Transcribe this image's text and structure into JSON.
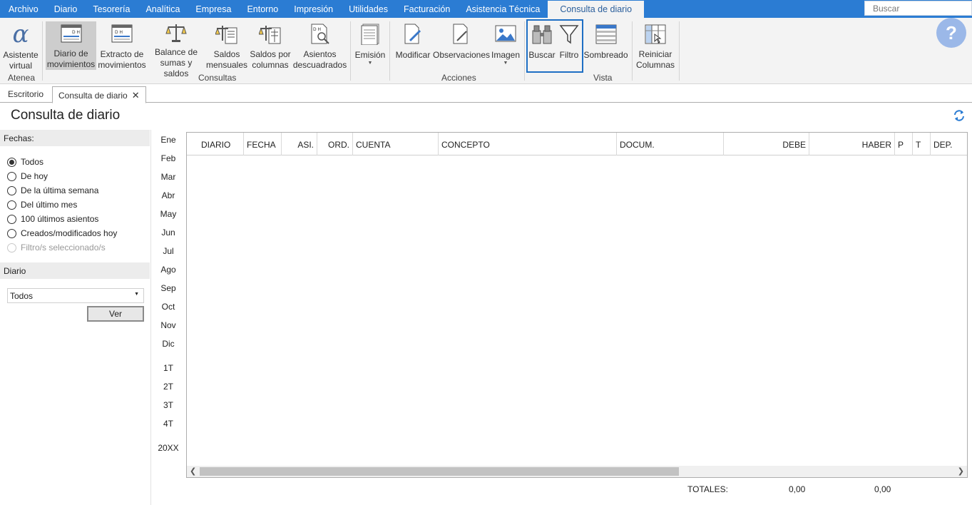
{
  "menubar": {
    "items": [
      "Archivo",
      "Diario",
      "Tesorería",
      "Analítica",
      "Empresa",
      "Entorno",
      "Impresión",
      "Utilidades",
      "Facturación",
      "Asistencia Técnica",
      "Consulta de diario"
    ],
    "search_placeholder": "Buscar"
  },
  "ribbon": {
    "atenea": {
      "asistente": "Asistente\nvirtual",
      "group": "Atenea"
    },
    "consultas": {
      "diario": "Diario de\nmovimientos",
      "extracto": "Extracto de\nmovimientos",
      "balance": "Balance de\nsumas y saldos",
      "saldos_mensuales": "Saldos\nmensuales",
      "saldos_columnas": "Saldos por\ncolumnas",
      "asientos": "Asientos\ndescuadrados",
      "group": "Consultas"
    },
    "emision": {
      "label": "Emisión"
    },
    "acciones": {
      "modificar": "Modificar",
      "observaciones": "Observaciones",
      "imagen": "Imagen",
      "group": "Acciones"
    },
    "vista": {
      "buscar": "Buscar",
      "filtro": "Filtro",
      "sombreado": "Sombreado",
      "reiniciar": "Reiniciar\nColumnas",
      "group": "Vista"
    },
    "help_glyph": "?"
  },
  "tabs": {
    "escritorio": "Escritorio",
    "consulta": "Consulta de diario",
    "close": "✕"
  },
  "page_title": "Consulta de diario",
  "fechas": {
    "heading": "Fechas:",
    "options": [
      "Todos",
      "De hoy",
      "De la última semana",
      "Del último mes",
      "100 últimos asientos",
      "Creados/modificados hoy",
      "Filtro/s seleccionado/s"
    ],
    "selected": "Todos"
  },
  "diario": {
    "heading": "Diario",
    "selected": "Todos",
    "ver_button": "Ver"
  },
  "months": [
    "Ene",
    "Feb",
    "Mar",
    "Abr",
    "May",
    "Jun",
    "Jul",
    "Ago",
    "Sep",
    "Oct",
    "Nov",
    "Dic"
  ],
  "quarters": [
    "1T",
    "2T",
    "3T",
    "4T"
  ],
  "year": "20XX",
  "grid": {
    "columns": [
      "DIARIO",
      "FECHA",
      "ASI.",
      "ORD.",
      "CUENTA",
      "CONCEPTO",
      "DOCUM.",
      "DEBE",
      "HABER",
      "P",
      "T",
      "DEP."
    ],
    "rows": []
  },
  "totals": {
    "label": "TOTALES:",
    "debe": "0,00",
    "haber": "0,00"
  }
}
